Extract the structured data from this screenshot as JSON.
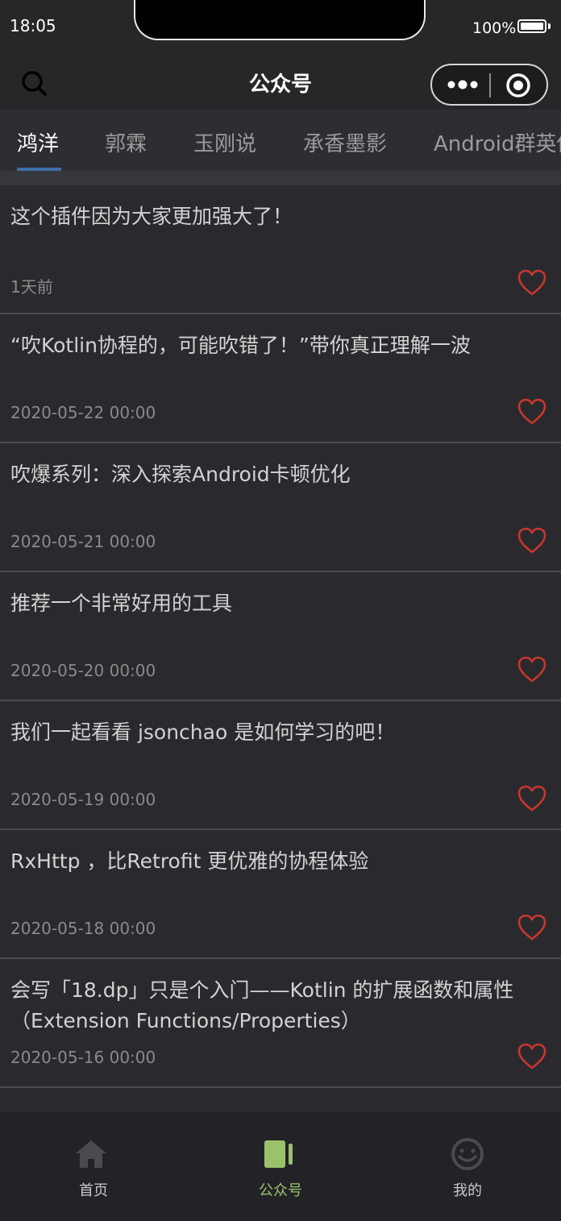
{
  "status_bar": {
    "time": "18:05",
    "battery_pct": "100%",
    "battery_level": 1.0
  },
  "nav": {
    "title": "公众号",
    "search_icon": "search-icon",
    "more_icon": "more-dots-icon",
    "close_icon": "close-target-icon"
  },
  "tabs": [
    {
      "label": "鸿洋",
      "active": true
    },
    {
      "label": "郭霖",
      "active": false
    },
    {
      "label": "玉刚说",
      "active": false
    },
    {
      "label": "承香墨影",
      "active": false
    },
    {
      "label": "Android群英传",
      "active": false
    }
  ],
  "articles": [
    {
      "title": "这个插件因为大家更加强大了！",
      "date": "1天前",
      "icon": "heart-icon"
    },
    {
      "title": "“吹Kotlin协程的，可能吹错了！”带你真正理解一波",
      "date": "2020-05-22 00:00",
      "icon": "heart-icon"
    },
    {
      "title": "吹爆系列：深入探索Android卡顿优化",
      "date": "2020-05-21 00:00",
      "icon": "heart-icon"
    },
    {
      "title": "推荐一个非常好用的工具",
      "date": "2020-05-20 00:00",
      "icon": "heart-icon"
    },
    {
      "title": "我们一起看看 jsonchao 是如何学习的吧！",
      "date": "2020-05-19 00:00",
      "icon": "heart-icon"
    },
    {
      "title": "RxHttp ，比Retrofit 更优雅的协程体验",
      "date": "2020-05-18 00:00",
      "icon": "heart-icon"
    },
    {
      "title": "会写「18.dp」只是个入门——Kotlin 的扩展函数和属性（Extension Functions/Properties）",
      "date": "2020-05-16 00:00",
      "icon": "heart-icon"
    }
  ],
  "bottom_nav": [
    {
      "label": "首页",
      "icon": "home-icon",
      "active": false
    },
    {
      "label": "公众号",
      "icon": "book-icon",
      "active": true
    },
    {
      "label": "我的",
      "icon": "smiley-icon",
      "active": false
    }
  ],
  "colors": {
    "accent": "#9bc26b",
    "heart": "#c8372d",
    "tab_indicator": "#3d6ea8",
    "background": "#2a2a2e"
  }
}
